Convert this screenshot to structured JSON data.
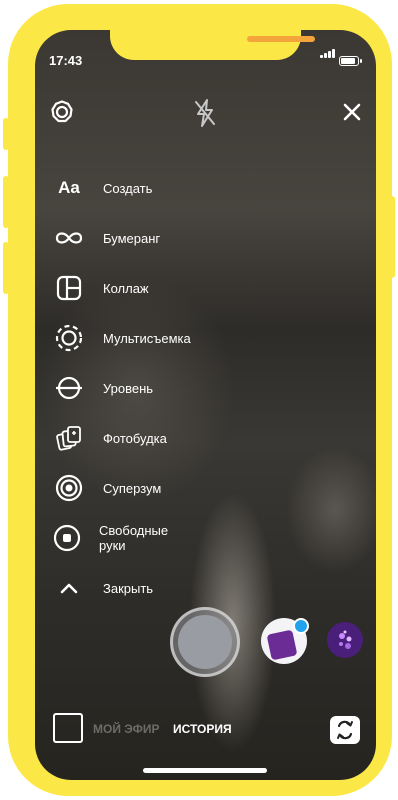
{
  "status_bar": {
    "time": "17:43"
  },
  "top_bar": {
    "settings_icon": "settings-icon",
    "flash_icon": "flash-off-icon",
    "close_icon": "close-icon"
  },
  "menu": {
    "items": [
      {
        "icon": "text-aa-icon",
        "icon_text": "Aa",
        "label": "Создать"
      },
      {
        "icon": "infinity-icon",
        "label": "Бумеранг"
      },
      {
        "icon": "collage-icon",
        "label": "Коллаж"
      },
      {
        "icon": "multicapture-icon",
        "label": "Мультисъемка"
      },
      {
        "icon": "level-icon",
        "label": "Уровень"
      },
      {
        "icon": "photobooth-icon",
        "label": "Фотобудка"
      },
      {
        "icon": "superzoom-icon",
        "label": "Суперзум"
      },
      {
        "icon": "hands-free-icon",
        "label": "Свободные руки"
      },
      {
        "icon": "chevron-up-icon",
        "label": "Закрыть"
      }
    ]
  },
  "bottom_bar": {
    "modes": [
      "МОЙ ЭФИР",
      "ИСТОРИЯ"
    ],
    "active_mode": "ИСТОРИЯ"
  },
  "colors": {
    "frame": "#fbe847",
    "notch_speaker": "#f3a43a",
    "effect_badge": "#20a2ef",
    "effect_purple": "#6b2c95"
  }
}
